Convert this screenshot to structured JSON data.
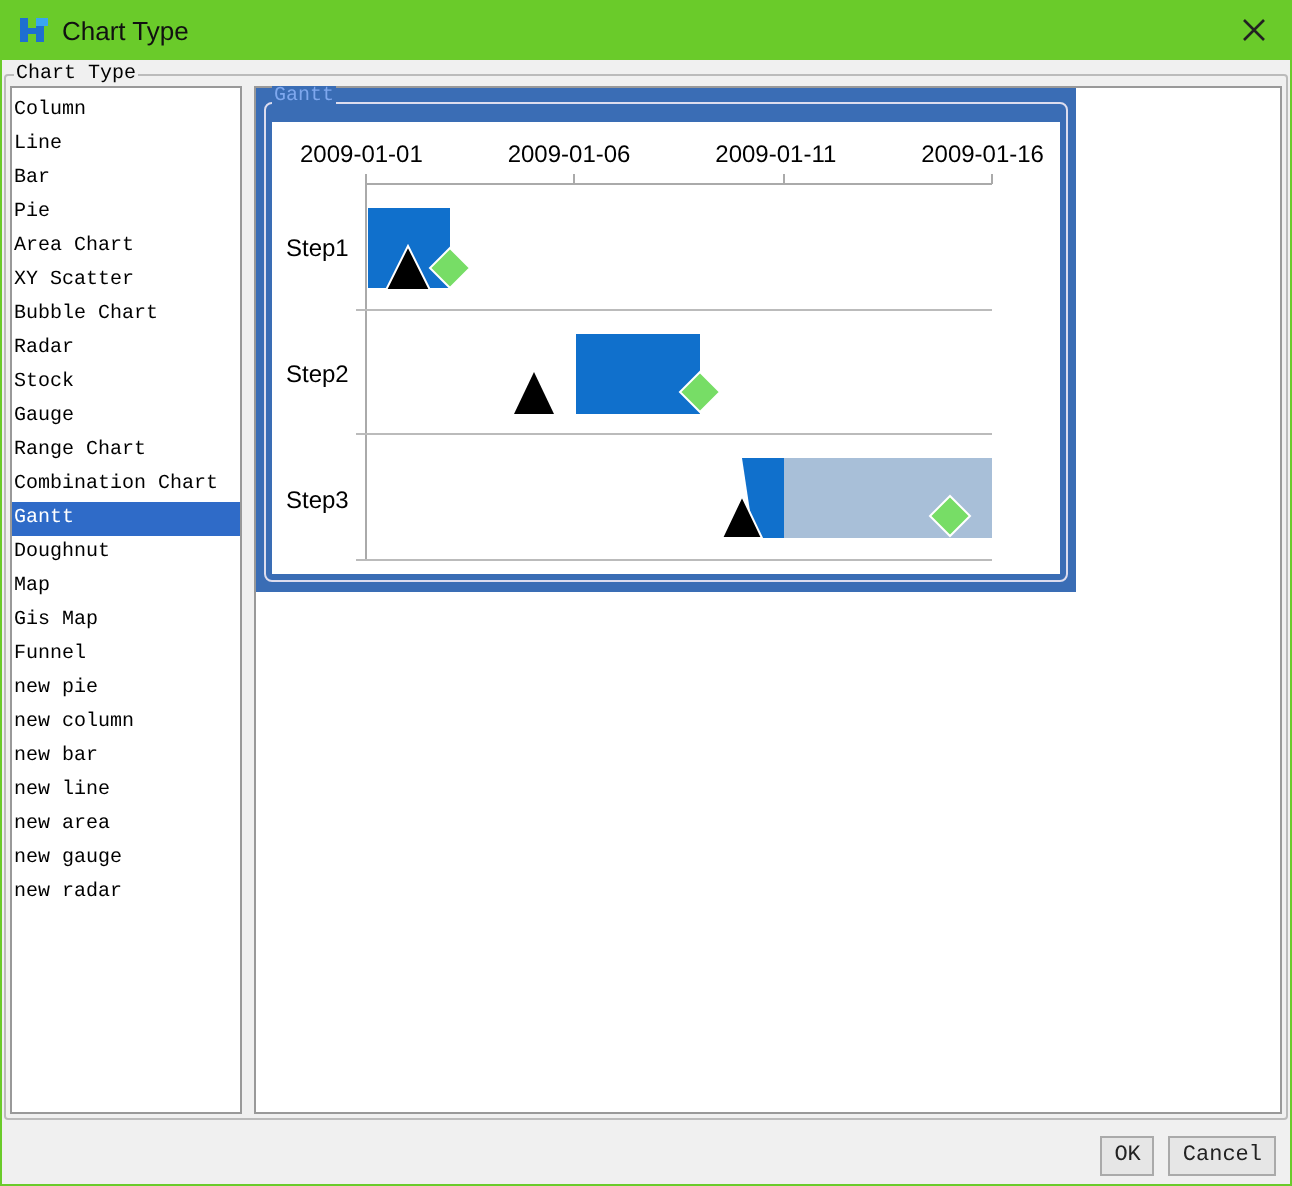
{
  "window": {
    "title": "Chart Type"
  },
  "group": {
    "label": "Chart Type"
  },
  "chart_types": [
    {
      "label": "Column",
      "selected": false
    },
    {
      "label": "Line",
      "selected": false
    },
    {
      "label": "Bar",
      "selected": false
    },
    {
      "label": "Pie",
      "selected": false
    },
    {
      "label": "Area Chart",
      "selected": false
    },
    {
      "label": "XY Scatter",
      "selected": false
    },
    {
      "label": "Bubble Chart",
      "selected": false
    },
    {
      "label": "Radar",
      "selected": false
    },
    {
      "label": "Stock",
      "selected": false
    },
    {
      "label": "Gauge",
      "selected": false
    },
    {
      "label": "Range Chart",
      "selected": false
    },
    {
      "label": "Combination Chart",
      "selected": false
    },
    {
      "label": "Gantt",
      "selected": true
    },
    {
      "label": "Doughnut",
      "selected": false
    },
    {
      "label": "Map",
      "selected": false
    },
    {
      "label": "Gis Map",
      "selected": false
    },
    {
      "label": "Funnel",
      "selected": false
    },
    {
      "label": "new pie",
      "selected": false
    },
    {
      "label": "new column",
      "selected": false
    },
    {
      "label": "new bar",
      "selected": false
    },
    {
      "label": "new line",
      "selected": false
    },
    {
      "label": "new area",
      "selected": false
    },
    {
      "label": "new gauge",
      "selected": false
    },
    {
      "label": "new radar",
      "selected": false
    }
  ],
  "preview": {
    "title": "Gantt",
    "dates": [
      "2009-01-01",
      "2009-01-06",
      "2009-01-11",
      "2009-01-16"
    ],
    "steps": [
      "Step1",
      "Step2",
      "Step3"
    ]
  },
  "buttons": [
    "OK",
    "Cancel"
  ]
}
